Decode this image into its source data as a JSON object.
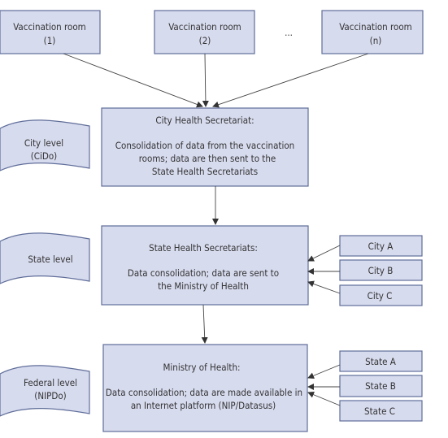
{
  "rooms": [
    {
      "line1": "Vaccination room",
      "line2": "(1)"
    },
    {
      "line1": "Vaccination room",
      "line2": "(2)"
    },
    {
      "line1": "Vaccination  room",
      "line2": "(n)"
    }
  ],
  "ellipsis": "...",
  "city_box": {
    "title": "City Health Secretariat:",
    "lines": [
      "Consolidation of data from the vaccination",
      "rooms; data are then sent to the",
      "State Health Secretariats"
    ]
  },
  "state_box": {
    "title": "State Health Secretariats:",
    "lines": [
      "Data consolidation; data are sent to",
      "the Ministry of Health"
    ]
  },
  "ministry_box": {
    "title": "Ministry of Health:",
    "lines": [
      "Data consolidation; data are made available in",
      "an Internet platform (NIP/Datasus)"
    ]
  },
  "levels": [
    {
      "line1": "City level",
      "line2": "(CiDo)"
    },
    {
      "line1": "State level",
      "line2": ""
    },
    {
      "line1": "Federal level",
      "line2": "(NIPDo)"
    }
  ],
  "cities": [
    "City A",
    "City B",
    "City C"
  ],
  "states": [
    "State A",
    "State B",
    "State C"
  ],
  "colors": {
    "box_fill": "#d7dbee",
    "box_border": "#5f6d99"
  }
}
